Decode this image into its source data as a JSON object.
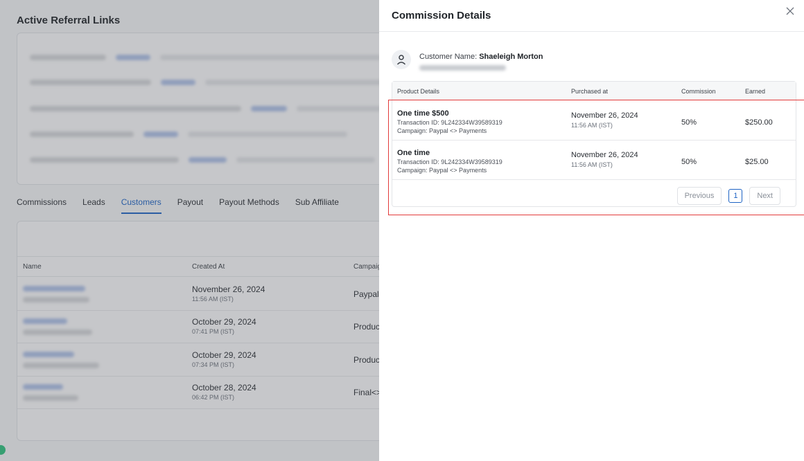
{
  "background": {
    "section_title": "Active Referral Links",
    "tabs": [
      {
        "label": "Commissions",
        "active": false
      },
      {
        "label": "Leads",
        "active": false
      },
      {
        "label": "Customers",
        "active": true
      },
      {
        "label": "Payout",
        "active": false
      },
      {
        "label": "Payout Methods",
        "active": false
      },
      {
        "label": "Sub Affiliate",
        "active": false
      }
    ],
    "customers_table": {
      "columns": [
        "Name",
        "Created At",
        "Campaig"
      ],
      "rows": [
        {
          "date": "November 26, 2024",
          "time": "11:56 AM (IST)",
          "campaign": "Paypal"
        },
        {
          "date": "October 29, 2024",
          "time": "07:41 PM (IST)",
          "campaign": "Produc"
        },
        {
          "date": "October 29, 2024",
          "time": "07:34 PM (IST)",
          "campaign": "Produc"
        },
        {
          "date": "October 28, 2024",
          "time": "06:42 PM (IST)",
          "campaign": "Final<>"
        }
      ]
    }
  },
  "drawer": {
    "title": "Commission Details",
    "close_icon": "close-icon",
    "customer": {
      "label": "Customer Name:",
      "name": "Shaeleigh Morton",
      "avatar_icon": "user-icon"
    },
    "table": {
      "columns": [
        "Product Details",
        "Purchased at",
        "Commission",
        "Earned"
      ],
      "rows": [
        {
          "product": "One time $500",
          "transaction": "Transaction ID: 9L242334W39589319",
          "campaign": "Campaign: Paypal <> Payments",
          "date": "November 26, 2024",
          "time": "11:56 AM (IST)",
          "commission": "50%",
          "earned": "$250.00"
        },
        {
          "product": "One time",
          "transaction": "Transaction ID: 9L242334W39589319",
          "campaign": "Campaign: Paypal <> Payments",
          "date": "November 26, 2024",
          "time": "11:56 AM (IST)",
          "commission": "50%",
          "earned": "$25.00"
        }
      ]
    },
    "pagination": {
      "previous": "Previous",
      "page": "1",
      "next": "Next"
    }
  },
  "colors": {
    "accent": "#1d63c4",
    "highlight": "#e23a3a",
    "status_dot": "#2ec27e"
  }
}
